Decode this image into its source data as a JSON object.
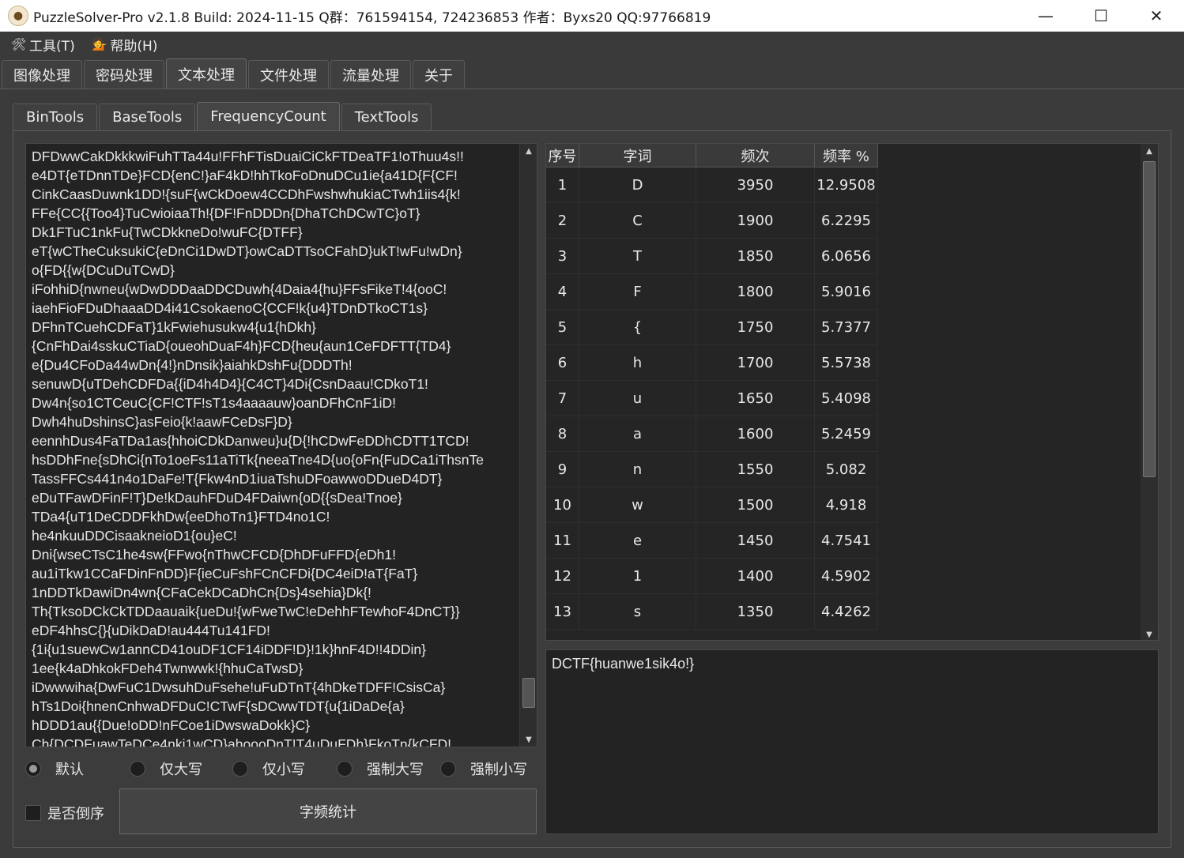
{
  "window": {
    "title": "PuzzleSolver-Pro v2.1.8  Build: 2024-11-15  Q群：761594154, 724236853  作者：Byxs20  QQ:97766819",
    "controls": {
      "minimize": "—",
      "maximize": "☐",
      "close": "✕"
    }
  },
  "menu": {
    "tools": {
      "icon": "🛠",
      "label": "工具(T)"
    },
    "help": {
      "icon": "💁",
      "label": "帮助(H)"
    }
  },
  "main_tabs": [
    "图像处理",
    "密码处理",
    "文本处理",
    "文件处理",
    "流量处理",
    "关于"
  ],
  "main_tab_active": "文本处理",
  "sub_tabs": [
    "BinTools",
    "BaseTools",
    "FrequencyCount",
    "TextTools"
  ],
  "sub_tab_active": "FrequencyCount",
  "input_text": "DFDwwCakDkkkwiFuhTTa44u!FFhFTisDuaiCiCkFTDeaTF1!oThuu4s!!\ne4DT{eTDnnTDe}FCD{enC!}aF4kD!hhTkoFoDnuDCu1ie{a41D{F{CF!\nCinkCaasDuwnk1DD!{suF{wCkDoew4CCDhFwshwhukiaCTwh1iis4{k!\nFFe{CC{{Too4}TuCwioiaaTh!{DF!FnDDDn{DhaTChDCwTC}oT}\nDk1FTuC1nkFu{TwCDkkneDo!wuFC{DTFF}\neT{wCTheCuksukiC{eDnCi1DwDT}owCaDTTsoCFahD}ukT!wFu!wDn}\no{FD{{w{DCuDuTCwD}\niFohhiD{nwneu{wDwDDDaaDDCDuwh{4Daia4{hu}FFsFikeT!4{ooC!\niaehFioFDuDhaaaDD4i41CsokaenoC{CCF!k{u4}TDnDTkoCT1s}\nDFhnTCuehCDFaT}1kFwiehusukw4{u1{hDkh}\n{CnFhDai4sskuCTiaD{oueohDuaF4h}FCD{heu{aun1CeFDFTT{TD4}\ne{Du4CFoDa44wDn{4!}nDnsik}aiahkDshFu{DDDTh!\nsenuwD{uTDehCDFDa{{iD4h4D4}{C4CT}4Di{CsnDaau!CDkoT1!\nDw4n{so1CTCeuC{CF!CTF!sT1s4aaaauw}oanDFhCnF1iD!\nDwh4huDshinsC}asFeio{k!aawFCeDsF}D}\neennhDus4FaTDa1as{hhoiCDkDanweu}u{D{!hCDwFeDDhCDTT1TCD!\nhsDDhFne{sDhCi{nTo1oeFs11aTiTk{neeaTne4D{uo{oFn{FuDCa1iThsnTe\nTassFFCs441n4o1DaFe!T{Fkw4nD1iuaTshuDFoawwoDDueD4DT}\neDuTFawDFinF!T}De!kDauhFDuD4FDaiwn{oD{{sDea!Tnoe}\nTDa4{uT1DeCDDFkhDw{eeDhoTn1}FTD4no1C!\nhe4nkuuDDCisaakneioD1{ou}eC!\nDni{wseCTsC1he4sw{FFwo{nThwCFCD{DhDFuFFD{eDh1!\nau1iTkw1CCaFDinFnDD}F{ieCuFshFCnCFDi{DC4eiD!aT{FaT}\n1nDDTkDawiDn4wn{CFaCekDCaDhCn{Ds}4sehia}Dk{!\nTh{TksoDCkCkTDDaauaik{ueDu!{wFweTwC!eDehhFTewhoF4DnCT}}\neDF4hhsC{}{uDikDaD!au444Tu141FD!\n{1i{u1suewCw1annCD41ouDF1CF14iDDF!D}!1k}hnF4D!!4DDin}\n1ee{k4aDhkokFDeh4Twnwwk!{hhuCaTwsD}\niDwwwiha{DwFuC1DwsuhDuFsehe!uFuDTnT{4hDkeTDFF!CsisCa}\nhTs1Doi{hnenCnhwaDFDuC!CTwF{sDCwwTDT{u{1iDaDe{a}\nhDDD1au{{Due!oDD!nFCoe1iDwswaDokk}C}\nCh{DCDFuawTeDCe4nki1wCD}ahoooDnT!T4uDuFDh}FkoTn{kCFD!",
  "case_options": [
    "默认",
    "仅大写",
    "仅小写",
    "强制大写",
    "强制小写"
  ],
  "case_selected": "默认",
  "reverse_label": "是否倒序",
  "reverse_checked": false,
  "count_button": "字频统计",
  "table": {
    "headers": [
      "序号",
      "字词",
      "频次",
      "频率 %"
    ],
    "rows": [
      [
        "1",
        "D",
        "3950",
        "12.9508"
      ],
      [
        "2",
        "C",
        "1900",
        "6.2295"
      ],
      [
        "3",
        "T",
        "1850",
        "6.0656"
      ],
      [
        "4",
        "F",
        "1800",
        "5.9016"
      ],
      [
        "5",
        "{",
        "1750",
        "5.7377"
      ],
      [
        "6",
        "h",
        "1700",
        "5.5738"
      ],
      [
        "7",
        "u",
        "1650",
        "5.4098"
      ],
      [
        "8",
        "a",
        "1600",
        "5.2459"
      ],
      [
        "9",
        "n",
        "1550",
        "5.082"
      ],
      [
        "10",
        "w",
        "1500",
        "4.918"
      ],
      [
        "11",
        "e",
        "1450",
        "4.7541"
      ],
      [
        "12",
        "1",
        "1400",
        "4.5902"
      ],
      [
        "13",
        "s",
        "1350",
        "4.4262"
      ]
    ]
  },
  "result": "DCTF{huanwe1sik4o!}"
}
